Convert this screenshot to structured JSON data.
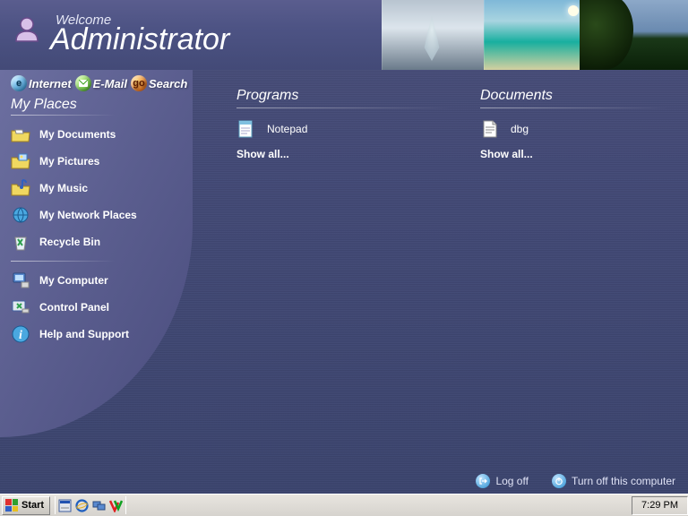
{
  "header": {
    "welcome": "Welcome",
    "username": "Administrator"
  },
  "quick": {
    "internet": "Internet",
    "email": "E-Mail",
    "search": "Search",
    "go_glyph": "go"
  },
  "places": {
    "title": "My Places",
    "items": [
      {
        "label": "My Documents"
      },
      {
        "label": "My Pictures"
      },
      {
        "label": "My Music"
      },
      {
        "label": "My Network Places"
      },
      {
        "label": "Recycle Bin"
      }
    ],
    "items2": [
      {
        "label": "My Computer"
      },
      {
        "label": "Control Panel"
      },
      {
        "label": "Help and Support"
      }
    ]
  },
  "programs": {
    "title": "Programs",
    "item": "Notepad",
    "showall": "Show all..."
  },
  "documents": {
    "title": "Documents",
    "item": "dbg",
    "showall": "Show all..."
  },
  "footer": {
    "logoff": "Log off",
    "turnoff": "Turn off this computer"
  },
  "taskbar": {
    "start": "Start",
    "clock": "7:29 PM"
  }
}
